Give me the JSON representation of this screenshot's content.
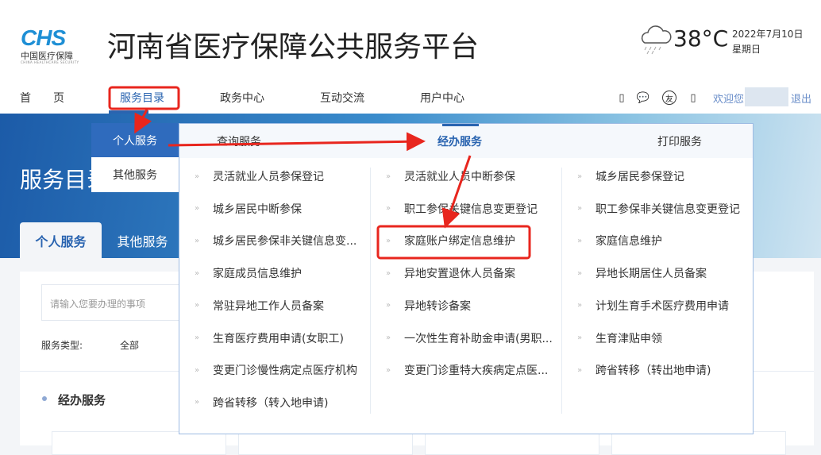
{
  "header": {
    "logo_mark": "CHS",
    "logo_cn": "中国医疗保障",
    "logo_en": "CHINA HEALTHCARE SECURITY",
    "title": "河南省医疗保障公共服务平台",
    "weather_icon": "cloud-rain-icon",
    "temperature": "38°C",
    "date": "2022年7月10日",
    "weekday": "星期日"
  },
  "nav": {
    "items": [
      "首　　页",
      "服务目录",
      "政务中心",
      "互动交流",
      "用户中心"
    ],
    "welcome": "欢迎您",
    "logout": "退出"
  },
  "banner": {
    "title": "服务目录"
  },
  "tabs": [
    "个人服务",
    "其他服务"
  ],
  "panel": {
    "search_placeholder": "请输入您要办理的事项",
    "service_type_label": "服务类型:",
    "service_type_value": "全部",
    "section_title": "经办服务"
  },
  "dropdown": {
    "left": [
      "个人服务",
      "其他服务"
    ],
    "tabs": [
      "查询服务",
      "经办服务",
      "打印服务"
    ],
    "columns": [
      [
        "灵活就业人员参保登记",
        "城乡居民中断参保",
        "城乡居民参保非关键信息变...",
        "家庭成员信息维护",
        "常驻异地工作人员备案",
        "生育医疗费用申请(女职工)",
        "变更门诊慢性病定点医疗机构",
        "跨省转移（转入地申请)"
      ],
      [
        "灵活就业人员中断参保",
        "职工参保关键信息变更登记",
        "家庭账户绑定信息维护",
        "异地安置退休人员备案",
        "异地转诊备案",
        "一次性生育补助金申请(男职...",
        "变更门诊重特大疾病定点医..."
      ],
      [
        "城乡居民参保登记",
        "职工参保非关键信息变更登记",
        "家庭信息维护",
        "异地长期居住人员备案",
        "计划生育手术医疗费用申请",
        "生育津贴申领",
        "跨省转移（转出地申请)"
      ]
    ]
  },
  "colors": {
    "accent": "#2a64b0",
    "annotation": "#e8261e"
  }
}
